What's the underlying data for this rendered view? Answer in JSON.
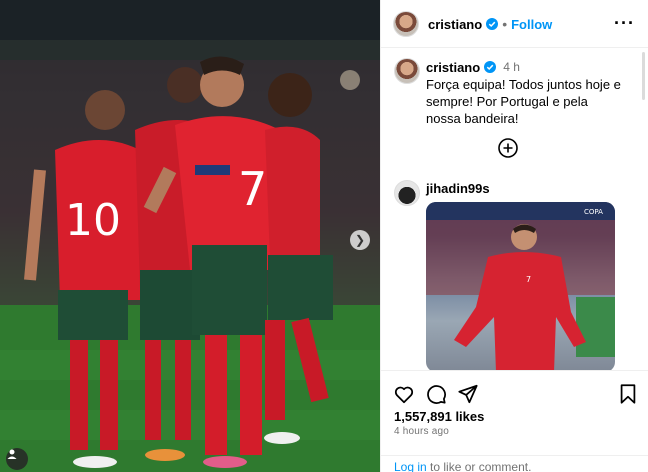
{
  "post": {
    "author": "cristiano",
    "follow_label": "Follow",
    "more_icon": "more-horizontal-icon",
    "caption_author": "cristiano",
    "caption_time": "4 h",
    "caption_text": "Força equipa! Todos juntos hoje e sempre! Por Portugal e pela nossa bandeira!",
    "likes": "1,557,891 likes",
    "time_ago": "4 hours ago"
  },
  "comment": {
    "author": "jihadin99s",
    "sticker_text": "COPA"
  },
  "login": {
    "link": "Log in",
    "rest": " to like or comment."
  },
  "colors": {
    "accent": "#0095f6",
    "verified": "#0095f6",
    "kit_red": "#d81e2c",
    "kit_green": "#1f4d36"
  }
}
